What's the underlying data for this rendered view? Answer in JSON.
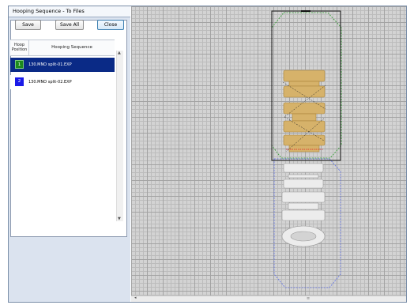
{
  "window": {
    "title": "Hooping Sequence - To Files"
  },
  "toolbar": {
    "save_label": "Save",
    "save_all_label": "Save All",
    "close_label": "Close"
  },
  "table": {
    "headers": {
      "hoop_position": "Hoop\nPosition",
      "hooping_sequence": "Hooping Sequence"
    },
    "rows": [
      {
        "position": "1",
        "file": "130.MNO split-01.EXP",
        "selected": true,
        "badge_color": "#1d8a1d"
      },
      {
        "position": "2",
        "file": "130.MNO split-02.EXP",
        "selected": false,
        "badge_color": "#1a1ae8"
      }
    ]
  },
  "icons": {
    "scroll_up": "chevron-up-icon",
    "scroll_down": "chevron-down-icon",
    "scroll_left": "chevron-left-icon"
  },
  "colors": {
    "selected_row": "#0a2a86",
    "canvas_bg": "#d3d3d3",
    "stitch_gold": "#d6b26a",
    "hoop_green": "#2e9b2e",
    "hoop_blue": "#5b6ee8"
  }
}
